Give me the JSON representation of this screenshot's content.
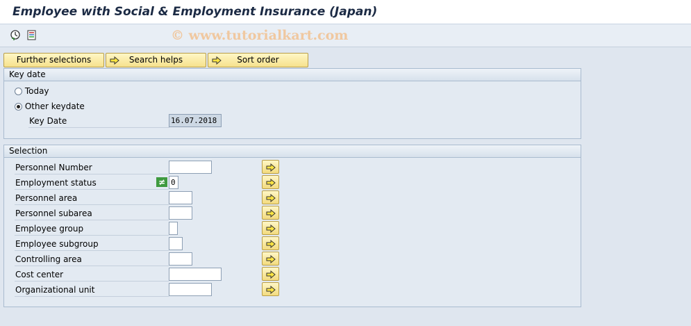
{
  "window": {
    "title": "Employee with Social & Employment Insurance (Japan)"
  },
  "toolbar": {
    "watermark": "© www.tutorialkart.com",
    "icons": [
      "execute-icon",
      "variant-icon"
    ]
  },
  "buttons": {
    "further_selections": "Further selections",
    "search_helps": "Search helps",
    "sort_order": "Sort order"
  },
  "key_date_group": {
    "title": "Key date",
    "today_label": "Today",
    "other_label": "Other keydate",
    "selected": "Other keydate",
    "key_date_label": "Key Date",
    "key_date_value": "16.07.2018"
  },
  "selection_group": {
    "title": "Selection",
    "rows": [
      {
        "label": "Personnel Number",
        "value": ""
      },
      {
        "label": "Employment status",
        "value": "0",
        "operator": "≠"
      },
      {
        "label": "Personnel area",
        "value": ""
      },
      {
        "label": "Personnel subarea",
        "value": ""
      },
      {
        "label": "Employee group",
        "value": ""
      },
      {
        "label": "Employee subgroup",
        "value": ""
      },
      {
        "label": "Controlling area",
        "value": ""
      },
      {
        "label": "Cost center",
        "value": ""
      },
      {
        "label": "Organizational unit",
        "value": ""
      }
    ]
  },
  "colors": {
    "button_yellow": "#f6e18c",
    "background": "#dfe6ef",
    "arrow": "#e8c21a"
  }
}
